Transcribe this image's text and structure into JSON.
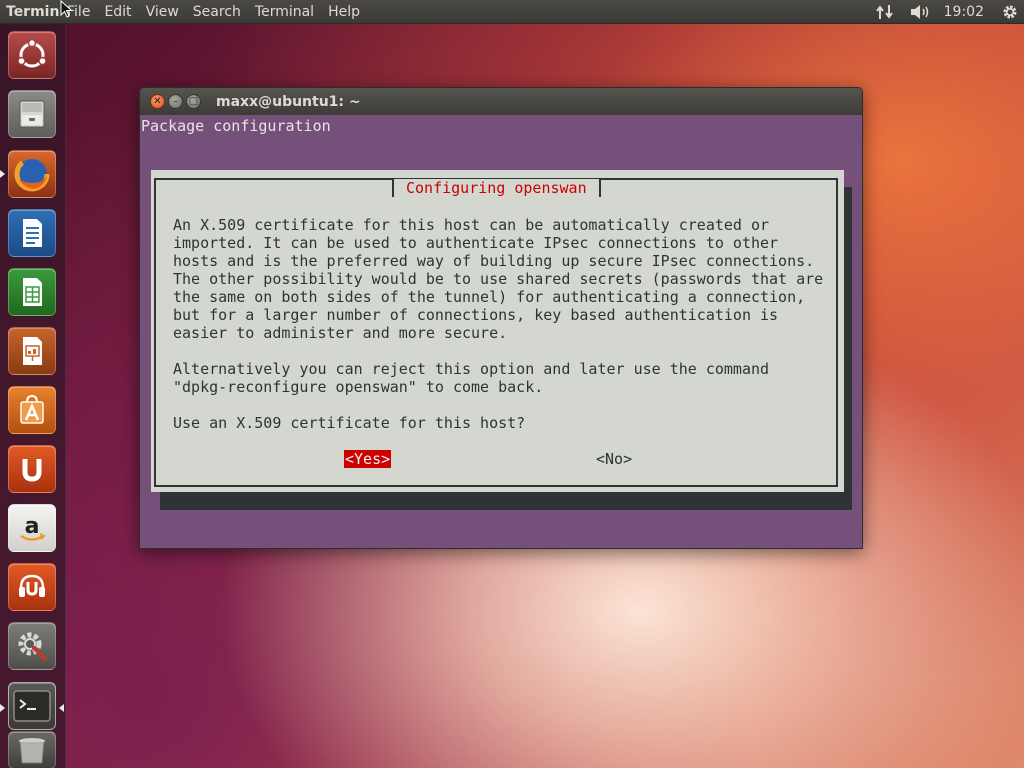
{
  "top_panel": {
    "app_name": "Terminal",
    "menus": [
      "File",
      "Edit",
      "View",
      "Search",
      "Terminal",
      "Help"
    ],
    "clock": "19:02",
    "indicators": [
      "network-icon",
      "volume-icon",
      "gear-icon"
    ]
  },
  "launcher": {
    "items": [
      {
        "name": "dash-home",
        "icon": "ubuntu-logo-icon"
      },
      {
        "name": "files",
        "icon": "file-cabinet-icon"
      },
      {
        "name": "firefox",
        "icon": "firefox-icon"
      },
      {
        "name": "libreoffice-writer",
        "icon": "writer-document-icon"
      },
      {
        "name": "libreoffice-calc",
        "icon": "calc-spreadsheet-icon"
      },
      {
        "name": "libreoffice-impress",
        "icon": "impress-presentation-icon"
      },
      {
        "name": "software-center",
        "icon": "shopping-bag-icon"
      },
      {
        "name": "ubuntu-one",
        "icon": "ubuntu-one-icon"
      },
      {
        "name": "amazon",
        "icon": "amazon-icon"
      },
      {
        "name": "ubuntu-one-music",
        "icon": "ubuntu-one-music-icon"
      },
      {
        "name": "system-settings",
        "icon": "settings-tools-icon"
      },
      {
        "name": "terminal",
        "icon": "terminal-icon"
      },
      {
        "name": "trash",
        "icon": "trash-icon"
      }
    ]
  },
  "window": {
    "title": "maxx@ubuntu1: ~",
    "buttons": [
      "close-icon",
      "minimize-icon",
      "maximize-icon"
    ]
  },
  "terminal": {
    "header": "Package configuration",
    "dialog": {
      "title": "Configuring openswan",
      "body": "An X.509 certificate for this host can be automatically created or\nimported. It can be used to authenticate IPsec connections to other\nhosts and is the preferred way of building up secure IPsec connections.\nThe other possibility would be to use shared secrets (passwords that are\nthe same on both sides of the tunnel) for authenticating a connection,\nbut for a larger number of connections, key based authentication is\neasier to administer and more secure.\n\nAlternatively you can reject this option and later use the command\n\"dpkg-reconfigure openswan\" to come back.\n\nUse an X.509 certificate for this host?",
      "yes_label": "<Yes>",
      "no_label": "<No>"
    }
  }
}
